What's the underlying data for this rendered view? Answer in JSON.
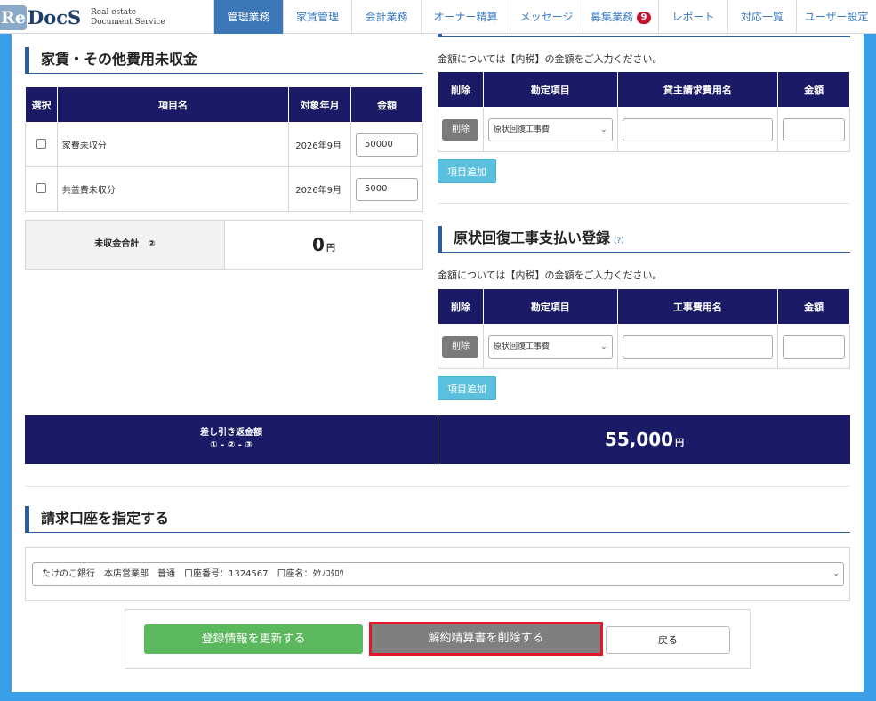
{
  "logo": {
    "re": "Re",
    "docs": "DocS",
    "line1": "Real estate",
    "line2": "Document Service"
  },
  "nav": [
    {
      "label": "管理業務",
      "active": true
    },
    {
      "label": "家賃管理"
    },
    {
      "label": "会計業務"
    },
    {
      "label": "オーナー精算"
    },
    {
      "label": "メッセージ"
    },
    {
      "label": "募集業務",
      "badge": "9"
    },
    {
      "label": "レポート"
    },
    {
      "label": "対応一覧"
    },
    {
      "label": "ユーザー設定"
    }
  ],
  "arrears": {
    "title": "家賃・その他費用未収金",
    "headers": [
      "選択",
      "項目名",
      "対象年月",
      "金額"
    ],
    "rows": [
      {
        "name": "家費未収分",
        "month": "2026年9月",
        "amount": "50000"
      },
      {
        "name": "共益費未収分",
        "month": "2026年9月",
        "amount": "5000"
      }
    ],
    "total_label": "未収金合計　②",
    "total_value": "0",
    "total_unit": "円"
  },
  "tenant_charges": {
    "note": "金額については【内税】の金額をご入力ください。",
    "headers": [
      "削除",
      "勘定項目",
      "貸主請求費用名",
      "金額"
    ],
    "delete_label": "削除",
    "select_value": "原状回復工事費",
    "add_label": "項目追加"
  },
  "restoration": {
    "title": "原状回復工事支払い登録",
    "help": "(?)",
    "note": "金額については【内税】の金額をご入力ください。",
    "headers": [
      "削除",
      "勘定項目",
      "工事費用名",
      "金額"
    ],
    "delete_label": "削除",
    "select_value": "原状回復工事費",
    "add_label": "項目追加"
  },
  "refund": {
    "label1": "差し引き返金額",
    "label2": "① - ② - ③",
    "value": "55,000",
    "unit": "円"
  },
  "billing": {
    "title": "請求口座を指定する",
    "account": "たけのこ銀行　本店営業部　普通　口座番号：1324567　口座名：ﾀｹﾉｺﾀﾛｳ"
  },
  "actions": {
    "update": "登録情報を更新する",
    "delete": "解約精算書を削除する",
    "back": "戻る"
  },
  "colors": {
    "header_navy": "#1a1a66",
    "update_green": "#5cb85c",
    "delete_gray": "#7f7f7f",
    "highlight_red": "#e0182a",
    "add_button_cyan": "#5bc0de",
    "frame_blue": "#3a9fe6"
  }
}
